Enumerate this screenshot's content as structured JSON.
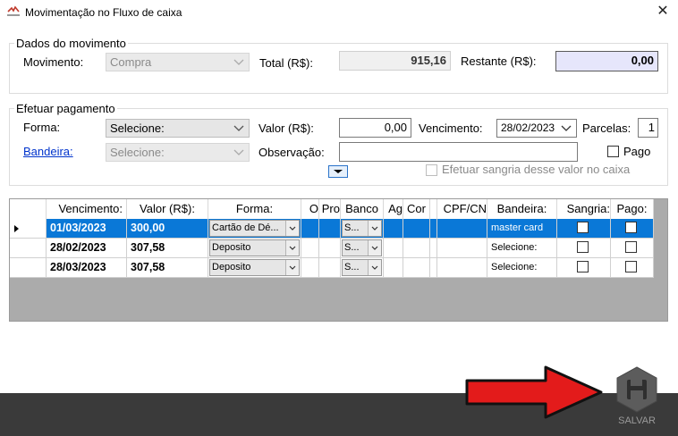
{
  "window": {
    "title": "Movimentação no Fluxo de caixa",
    "close_glyph": "✕"
  },
  "movimento": {
    "legend": "Dados do movimento",
    "movimento_label": "Movimento:",
    "movimento_value": "Compra",
    "total_label": "Total (R$):",
    "total_value": "915,16",
    "restante_label": "Restante (R$):",
    "restante_value": "0,00"
  },
  "pagamento": {
    "legend": "Efetuar pagamento",
    "forma_label": "Forma:",
    "forma_value": "Selecione:",
    "valor_label": "Valor (R$):",
    "valor_value": "0,00",
    "vencimento_label": "Vencimento:",
    "vencimento_value": "28/02/2023",
    "parcelas_label": "Parcelas:",
    "parcelas_value": "1",
    "bandeira_label": "Bandeira:",
    "bandeira_value": "Selecione:",
    "observacao_label": "Observação:",
    "observacao_value": "",
    "pago_label": "Pago",
    "sangria_label": "Efetuar sangria desse valor no caixa"
  },
  "grid": {
    "headers": [
      "Vencimento:",
      "Valor (R$):",
      "Forma:",
      "O",
      "Pro",
      "Banco",
      "Ag",
      "Cor",
      "",
      "CPF/CN",
      "Bandeira:",
      "Sangria:",
      "Pago:"
    ],
    "rows": [
      {
        "vencimento": "01/03/2023",
        "valor": "300,00",
        "forma": "Cartão de Dé...",
        "banco": "S...",
        "bandeira": "master card",
        "selected": true
      },
      {
        "vencimento": "28/02/2023",
        "valor": "307,58",
        "forma": "Deposito",
        "banco": "S...",
        "bandeira": "Selecione:",
        "selected": false
      },
      {
        "vencimento": "28/03/2023",
        "valor": "307,58",
        "forma": "Deposito",
        "banco": "S...",
        "bandeira": "Selecione:",
        "selected": false
      }
    ]
  },
  "footer": {
    "save_label": "SALVAR"
  },
  "colors": {
    "selection": "#0a78d7",
    "footer": "#3a3a3a",
    "highlight_field": "#e6e6fb",
    "arrow": "#e31b1b"
  },
  "icons": {
    "app": "app-logo-icon",
    "close": "close-icon",
    "dropdown": "chevron-down-icon",
    "save": "floppy-disk-icon",
    "pointer": "red-arrow-icon"
  }
}
